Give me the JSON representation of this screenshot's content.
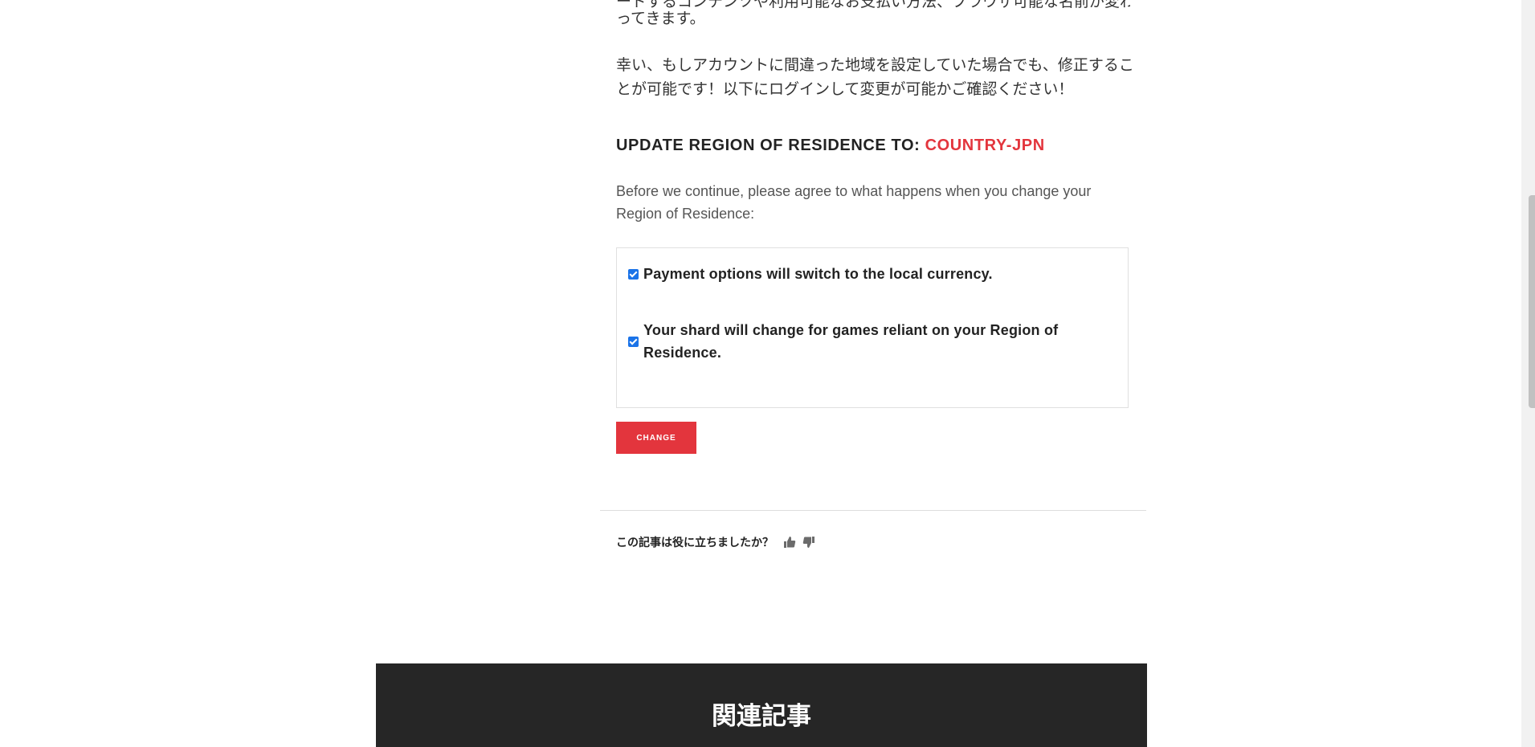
{
  "article": {
    "partial_top_line": "ードするコンテンツや利用可能なお支払い方法、ブラウザ可能な名前が変わ",
    "continued_line": "ってきます。",
    "paragraph_lines": [
      "幸い、もしアカウントに間違った地域を設定していた場合でも、修正するこ",
      "とが可能です！以下にログインして変更が可能かご確認ください！"
    ]
  },
  "region_update": {
    "heading_prefix": "UPDATE REGION OF RESIDENCE TO: ",
    "country_code": "COUNTRY-JPN",
    "intro_lines": [
      "Before we continue, please agree to what happens when you change your",
      "Region of Residence:"
    ],
    "agreements": [
      {
        "checked": true,
        "lines": [
          "Payment options will switch to the local currency."
        ]
      },
      {
        "checked": true,
        "lines": [
          "Your shard will change for games reliant on your Region of",
          "Residence."
        ]
      }
    ],
    "change_button_label": "CHANGE"
  },
  "feedback": {
    "question": "この記事は役に立ちましたか？",
    "thumbs_up_icon": "thumbs-up-icon",
    "thumbs_down_icon": "thumbs-down-icon"
  },
  "related": {
    "title": "関連記事"
  },
  "colors": {
    "accent_red": "#e3353d",
    "related_bg": "#262626",
    "checkbox_blue": "#1a73e8"
  }
}
